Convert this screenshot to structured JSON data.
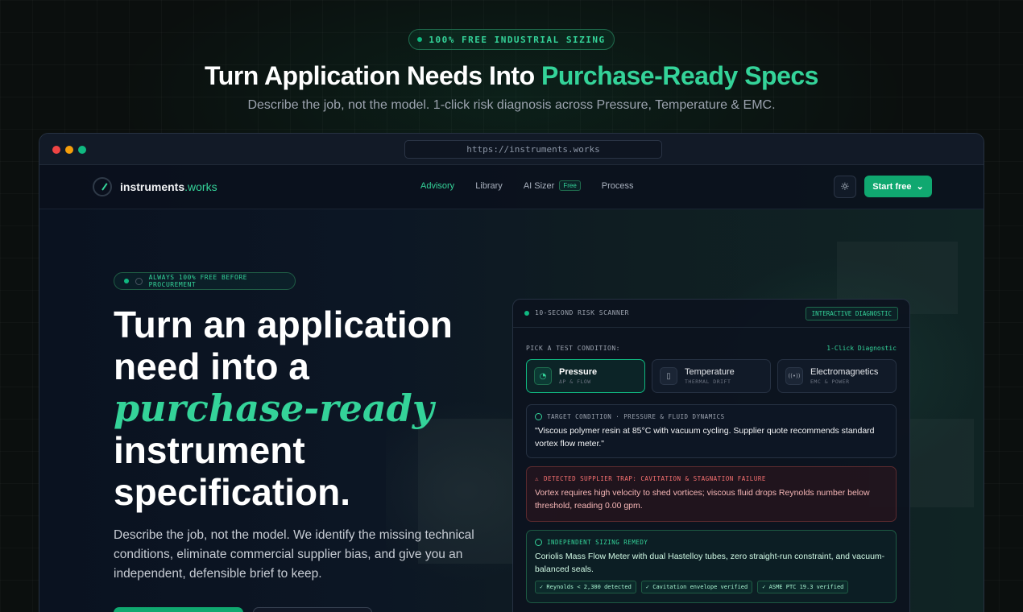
{
  "top_badge": "100% FREE INDUSTRIAL SIZING",
  "hero": {
    "title_main": "Turn Application Needs Into ",
    "title_accent": "Purchase-Ready Specs",
    "subtitle": "Describe the job, not the model. 1-click risk diagnosis across Pressure, Temperature & EMC."
  },
  "browser": {
    "url": "https://instruments.works"
  },
  "nav": {
    "logo_main": "instruments",
    "logo_domain": ".works",
    "links": [
      "Advisory",
      "Library",
      "AI Sizer",
      "Process"
    ],
    "ai_sizer_tag": "Free",
    "start_label": "Start free",
    "start_chevron": "⌄",
    "theme_icon": "☼"
  },
  "left": {
    "badge": "ALWAYS 100% FREE BEFORE PROCUREMENT",
    "title_line1": "Turn an application",
    "title_line2": "need into a",
    "title_italic": "purchase-ready",
    "title_line4": "instrument",
    "title_line5": "specification.",
    "description": "Describe the job, not the model. We identify the missing technical conditions, eliminate commercial supplier bias, and give you an independent, defensible brief to keep."
  },
  "scanner": {
    "title": "10-SECOND RISK SCANNER",
    "tag": "INTERACTIVE DIAGNOSTIC",
    "pick_label": "PICK A TEST CONDITION:",
    "pick_right": "1-Click Diagnostic",
    "tabs": [
      {
        "name": "Pressure",
        "sub": "ΔP & FLOW",
        "icon": "◔"
      },
      {
        "name": "Temperature",
        "sub": "THERMAL DRIFT",
        "icon": "▯"
      },
      {
        "name": "Electromagnetics",
        "sub": "EMC & POWER",
        "icon": "((•))"
      }
    ],
    "target_head": "TARGET CONDITION · PRESSURE & FLUID DYNAMICS",
    "target_body": "\"Viscous polymer resin at 85°C with vacuum cycling. Supplier quote recommends standard vortex flow meter.\"",
    "trap_head": "DETECTED SUPPLIER TRAP: CAVITATION & STAGNATION FAILURE",
    "trap_body": "Vortex requires high velocity to shed vortices; viscous fluid drops Reynolds number below threshold, reading 0.00 gpm.",
    "remedy_head": "INDEPENDENT SIZING REMEDY",
    "remedy_body": "Coriolis Mass Flow Meter with dual Hastelloy tubes, zero straight-run constraint, and vacuum-balanced seals.",
    "checks": [
      "✓ Reynolds < 2,300 detected",
      "✓ Cavitation envelope verified",
      "✓ ASME PTC 19.3 verified"
    ],
    "trap_icon": "⚠"
  }
}
